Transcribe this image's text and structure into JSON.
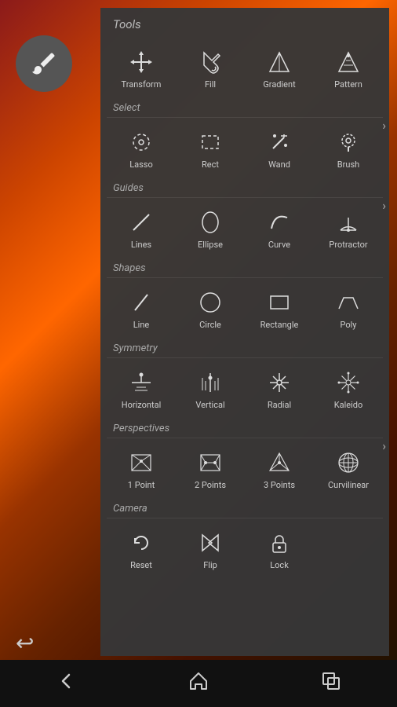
{
  "panel": {
    "title": "Tools",
    "sections": [
      {
        "label": null,
        "items": [
          {
            "id": "transform",
            "label": "Transform",
            "icon": "move"
          },
          {
            "id": "fill",
            "label": "Fill",
            "icon": "fill"
          },
          {
            "id": "gradient",
            "label": "Gradient",
            "icon": "gradient"
          },
          {
            "id": "pattern",
            "label": "Pattern",
            "icon": "pattern"
          }
        ]
      },
      {
        "label": "Select",
        "items": [
          {
            "id": "lasso",
            "label": "Lasso",
            "icon": "lasso"
          },
          {
            "id": "rect",
            "label": "Rect",
            "icon": "rect"
          },
          {
            "id": "wand",
            "label": "Wand",
            "icon": "wand"
          },
          {
            "id": "brush",
            "label": "Brush",
            "icon": "brush-select"
          }
        ]
      },
      {
        "label": "Guides",
        "items": [
          {
            "id": "lines",
            "label": "Lines",
            "icon": "line-diag"
          },
          {
            "id": "ellipse",
            "label": "Ellipse",
            "icon": "ellipse"
          },
          {
            "id": "curve",
            "label": "Curve",
            "icon": "curve"
          },
          {
            "id": "protractor",
            "label": "Protractor",
            "icon": "protractor"
          }
        ]
      },
      {
        "label": "Shapes",
        "items": [
          {
            "id": "line",
            "label": "Line",
            "icon": "line"
          },
          {
            "id": "circle",
            "label": "Circle",
            "icon": "circle"
          },
          {
            "id": "rectangle",
            "label": "Rectangle",
            "icon": "rectangle"
          },
          {
            "id": "poly",
            "label": "Poly",
            "icon": "poly"
          }
        ]
      },
      {
        "label": "Symmetry",
        "items": [
          {
            "id": "horizontal",
            "label": "Horizontal",
            "icon": "horizontal"
          },
          {
            "id": "vertical",
            "label": "Vertical",
            "icon": "vertical"
          },
          {
            "id": "radial",
            "label": "Radial",
            "icon": "radial"
          },
          {
            "id": "kaleido",
            "label": "Kaleido",
            "icon": "kaleido"
          }
        ]
      },
      {
        "label": "Perspectives",
        "items": [
          {
            "id": "1point",
            "label": "1 Point",
            "icon": "1point"
          },
          {
            "id": "2points",
            "label": "2 Points",
            "icon": "2points"
          },
          {
            "id": "3points",
            "label": "3 Points",
            "icon": "3points"
          },
          {
            "id": "curvilinear",
            "label": "Curvilinear",
            "icon": "curvilinear"
          }
        ]
      },
      {
        "label": "Camera",
        "items": [
          {
            "id": "reset",
            "label": "Reset",
            "icon": "reset"
          },
          {
            "id": "flip",
            "label": "Flip",
            "icon": "flip"
          },
          {
            "id": "lock",
            "label": "Lock",
            "icon": "lock"
          }
        ]
      }
    ]
  },
  "bottomNav": {
    "back": "↩",
    "home": "⌂",
    "recent": "▣"
  }
}
